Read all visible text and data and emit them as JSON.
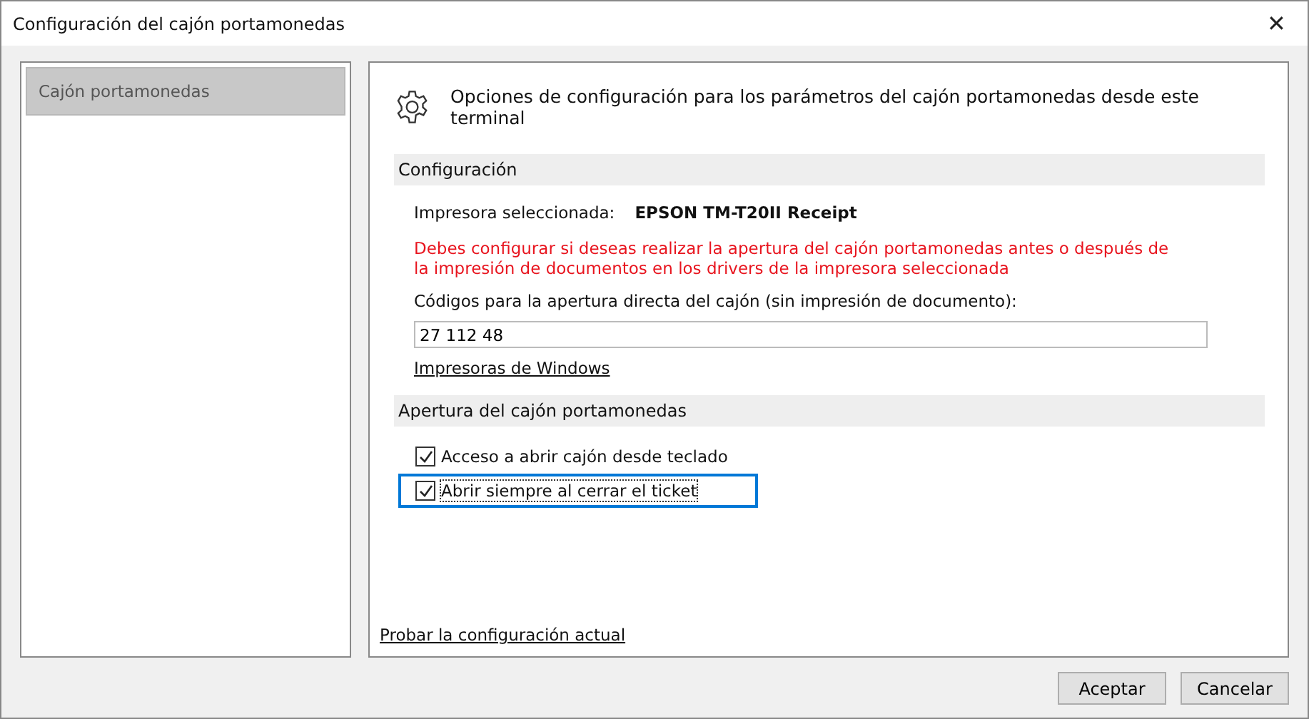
{
  "window": {
    "title": "Configuración del cajón portamonedas",
    "close": "✕"
  },
  "sidebar": {
    "items": [
      {
        "label": "Cajón portamonedas",
        "selected": true
      }
    ]
  },
  "header": "Opciones de configuración para los parámetros del cajón portamonedas desde este terminal",
  "sections": [
    {
      "title": "Configuración",
      "printer_label": "Impresora seleccionada:",
      "printer_value": "EPSON TM-T20II Receipt",
      "warning": "Debes configurar si deseas realizar la apertura del cajón portamonedas antes o después de la impresión de documentos en los drivers de la impresora seleccionada",
      "codes_label": "Códigos para la apertura directa del cajón (sin impresión de documento):",
      "codes_value": "27 112 48",
      "link": "Impresoras de Windows"
    },
    {
      "title": "Apertura del cajón portamonedas",
      "options": [
        {
          "label": "Acceso a abrir cajón desde teclado",
          "checked": true,
          "focused": false
        },
        {
          "label": "Abrir siempre al cerrar el ticket",
          "checked": true,
          "focused": true
        }
      ]
    }
  ],
  "test_link": "Probar la configuración actual",
  "buttons": [
    "Aceptar",
    "Cancelar"
  ]
}
